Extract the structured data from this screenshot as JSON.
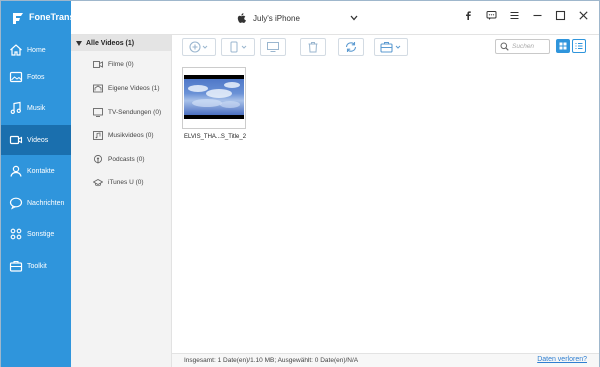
{
  "app": {
    "name": "FoneTrans",
    "brand_color": "#2f95dc",
    "active_color": "#1a6fae"
  },
  "device": {
    "name": "July's iPhone",
    "icon": "apple-icon"
  },
  "window_controls": [
    "facebook-icon",
    "feedback-icon",
    "menu-icon",
    "minimize-icon",
    "maximize-icon",
    "close-icon"
  ],
  "sidebar": {
    "items": [
      {
        "label": "Home",
        "icon": "home-icon",
        "active": false
      },
      {
        "label": "Fotos",
        "icon": "photos-icon",
        "active": false
      },
      {
        "label": "Musik",
        "icon": "music-icon",
        "active": false
      },
      {
        "label": "Videos",
        "icon": "video-icon",
        "active": true
      },
      {
        "label": "Kontakte",
        "icon": "contacts-icon",
        "active": false
      },
      {
        "label": "Nachrichten",
        "icon": "messages-icon",
        "active": false
      },
      {
        "label": "Sonstige",
        "icon": "other-icon",
        "active": false
      },
      {
        "label": "Toolkit",
        "icon": "toolkit-icon",
        "active": false
      }
    ]
  },
  "categories": {
    "header": "Alle Videos (1)",
    "items": [
      {
        "label": "Filme (0)",
        "icon": "film-icon"
      },
      {
        "label": "Eigene Videos (1)",
        "icon": "home-video-icon"
      },
      {
        "label": "TV-Sendungen (0)",
        "icon": "tv-icon"
      },
      {
        "label": "Musikvideos (0)",
        "icon": "music-video-icon"
      },
      {
        "label": "Podcasts (0)",
        "icon": "podcast-icon"
      },
      {
        "label": "iTunes U (0)",
        "icon": "itunes-u-icon"
      }
    ]
  },
  "toolbar": {
    "buttons": [
      "add-icon",
      "export-device-icon",
      "export-pc-icon",
      "delete-icon",
      "sync-icon",
      "toolbox-icon"
    ]
  },
  "search": {
    "placeholder": "Suchen"
  },
  "files": [
    {
      "name": "ELVIS_THA...S_Title_2"
    }
  ],
  "status": {
    "summary": "Insgesamt: 1 Date(en)/1.10 MB; Ausgewählt: 0 Date(en)/N/A",
    "link": "Daten verloren?"
  }
}
